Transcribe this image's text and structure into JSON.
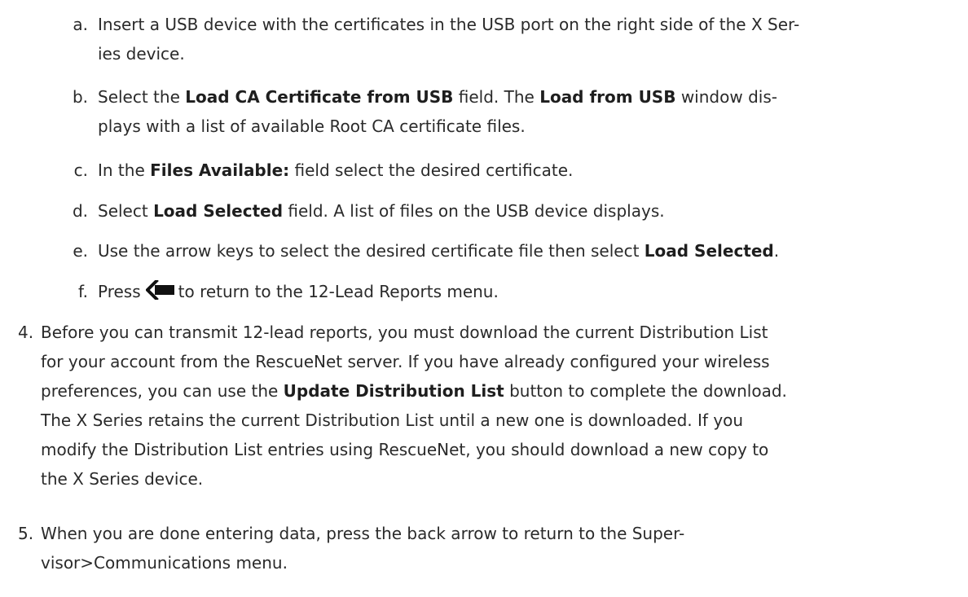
{
  "steps": {
    "a": {
      "marker": "a.",
      "line1": "Insert a USB device with the certificates in the USB port on the right side of the X Ser-",
      "line2": "ies device."
    },
    "b": {
      "marker": "b.",
      "t1": "Select the ",
      "b1": "Load CA Certificate from USB",
      "t2": " field. The ",
      "b2": "Load from USB",
      "t3": " window dis-",
      "line2": "plays with a list of available Root CA certificate files."
    },
    "c": {
      "marker": "c.",
      "t1": "In the ",
      "b1": "Files Available:",
      "t2": " field select the desired certificate."
    },
    "d": {
      "marker": "d.",
      "t1": "Select ",
      "b1": "Load Selected",
      "t2": " field. A list of files on the USB device displays."
    },
    "e": {
      "marker": "e.",
      "t1": "Use the arrow keys to select the desired certificate file then select ",
      "b1": "Load Selected",
      "t2": "."
    },
    "f": {
      "marker": "f.",
      "t1": "Press",
      "icon": "back-arrow-icon",
      "t2": "to return to the 12-Lead Reports menu."
    },
    "s4": {
      "marker": "4.",
      "line1": "Before you can transmit 12-lead reports, you must download the current Distribution List",
      "line2": "for your account from the RescueNet server. If you have already configured your wireless",
      "l3a": "preferences, you can use the ",
      "l3b": "Update Distribution List",
      "l3c": " button to complete the download.",
      "line4": "The X Series retains the current Distribution List until a new one is downloaded. If you",
      "line5": "modify the Distribution List entries using RescueNet, you should download a new copy to",
      "line6": "the X Series device."
    },
    "s5": {
      "marker": "5.",
      "line1": "When you are done entering data, press the back arrow to return to the Super-",
      "line2": "visor>Communications menu."
    }
  },
  "colors": {
    "text": "#2a2a2a",
    "icon": "#111111"
  }
}
